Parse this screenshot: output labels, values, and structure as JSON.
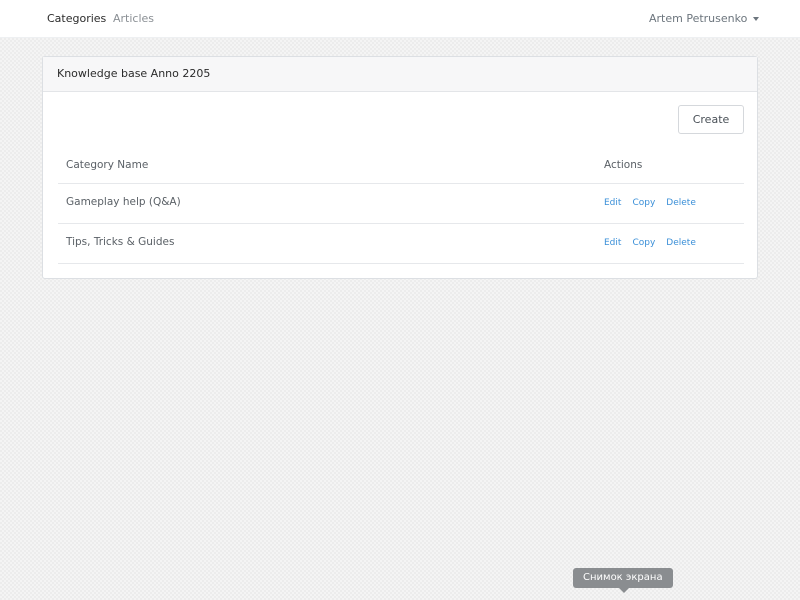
{
  "nav": {
    "categories_label": "Categories",
    "articles_label": "Articles",
    "user_name": "Artem Petrusenko"
  },
  "card": {
    "title": "Knowledge base Anno 2205",
    "create_label": "Create"
  },
  "table": {
    "headers": {
      "name": "Category Name",
      "actions": "Actions"
    },
    "rows": [
      {
        "name": "Gameplay help (Q&A)",
        "edit": "Edit",
        "copy": "Copy",
        "delete": "Delete"
      },
      {
        "name": "Tips, Tricks & Guides",
        "edit": "Edit",
        "copy": "Copy",
        "delete": "Delete"
      }
    ]
  },
  "tooltip": {
    "text": "Снимок экрана"
  },
  "colors": {
    "link": "#3a8fd8",
    "header_bg": "#f7f7f8"
  }
}
